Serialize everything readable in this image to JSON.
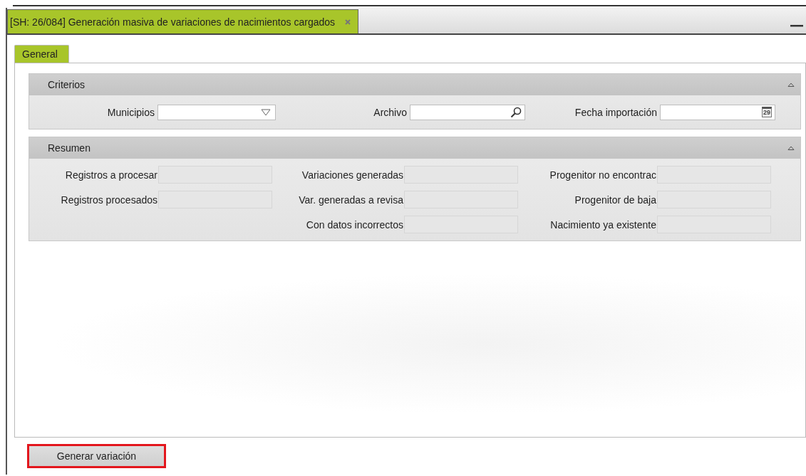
{
  "window": {
    "title": "[SH: 26/084] Generación masiva de variaciones de nacimientos cargados",
    "selected": true
  },
  "tabs": [
    {
      "label": "General",
      "selected": true
    }
  ],
  "sections": [
    {
      "title": "Criterios",
      "expanded": true,
      "kind": "criteria",
      "fields": [
        {
          "label": "Municipios",
          "kind": "dropdown"
        },
        {
          "label": "Archivo",
          "kind": "search"
        },
        {
          "label": "Fecha importación",
          "kind": "date",
          "icon_text": "29"
        }
      ]
    },
    {
      "title": "Resumen",
      "expanded": true,
      "kind": "summary",
      "columns": [
        [
          {
            "label": "Registros a procesar"
          },
          {
            "label": "Registros procesados"
          }
        ],
        [
          {
            "label": "Variaciones generadas"
          },
          {
            "label": "Var. generadas a revisa"
          },
          {
            "label": "Con datos incorrectos"
          }
        ],
        [
          {
            "label": "Progenitor no encontrac"
          },
          {
            "label": "Progenitor de baja"
          },
          {
            "label": "Nacimiento ya existente"
          }
        ]
      ]
    }
  ],
  "buttons": [
    {
      "label": "Generar variación",
      "highlighted": true
    }
  ]
}
